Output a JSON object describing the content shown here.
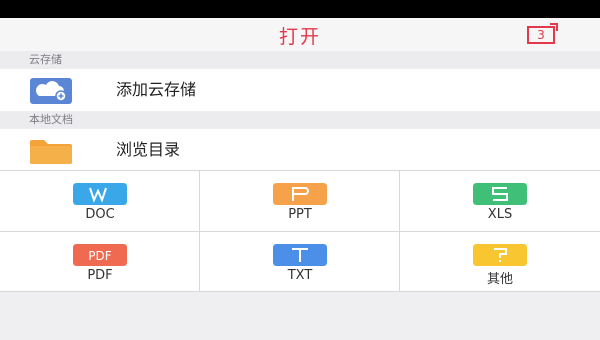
{
  "header": {
    "title": "打开",
    "badge_count": "3"
  },
  "sections": {
    "cloud": {
      "label": "云存储",
      "add_label": "添加云存储"
    },
    "local": {
      "label": "本地文档",
      "browse_label": "浏览目录"
    }
  },
  "file_types": [
    {
      "label": "DOC",
      "icon": "W",
      "color": "#3aa8e8"
    },
    {
      "label": "PPT",
      "icon": "P",
      "color": "#f5a24a"
    },
    {
      "label": "XLS",
      "icon": "S",
      "color": "#3fbf77"
    },
    {
      "label": "PDF",
      "icon": "PDF",
      "color": "#f06a52"
    },
    {
      "label": "TXT",
      "icon": "T",
      "color": "#4b8fe8"
    },
    {
      "label": "其他",
      "icon": "?",
      "color": "#f7c630"
    }
  ]
}
